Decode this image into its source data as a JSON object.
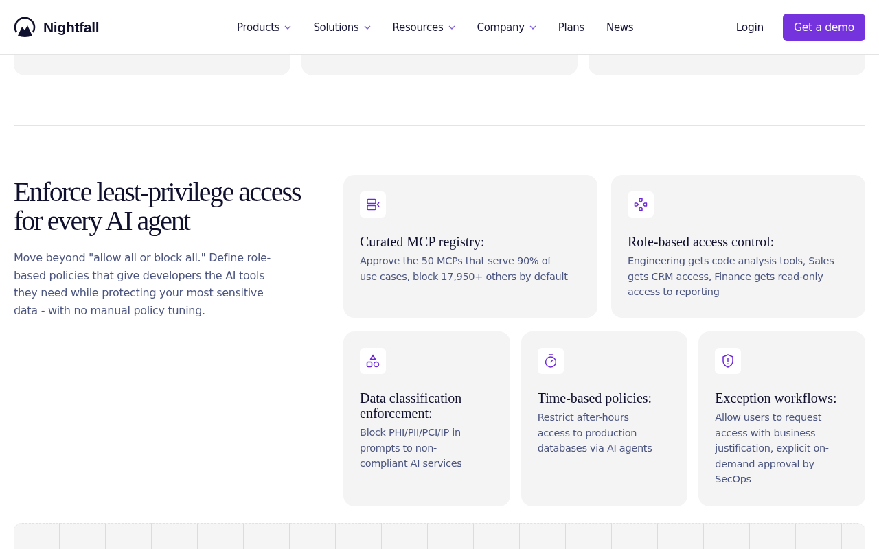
{
  "header": {
    "brand": "Nightfall",
    "nav": [
      {
        "label": "Products",
        "dropdown": true
      },
      {
        "label": "Solutions",
        "dropdown": true
      },
      {
        "label": "Resources",
        "dropdown": true
      },
      {
        "label": "Company",
        "dropdown": true
      },
      {
        "label": "Plans",
        "dropdown": false
      },
      {
        "label": "News",
        "dropdown": false
      }
    ],
    "login": "Login",
    "cta": "Get a demo"
  },
  "section": {
    "heading": "Enforce least-privilege access for every AI agent",
    "description": "Move beyond \"allow all or block all.\" Define role-based policies that give developers the AI tools they need while protecting your most sensitive data - with no manual policy tuning.",
    "features": [
      {
        "kind": "registry",
        "title": "Curated MCP registry:",
        "text": "Approve the 50 MCPs that serve 90% of use cases, block 17,950+ others by default"
      },
      {
        "kind": "roles",
        "title": "Role-based access control:",
        "text": "Engineering gets code analysis tools, Sales gets CRM access, Finance gets read-only access to reporting"
      },
      {
        "kind": "classification",
        "title": "Data classification enforcement:",
        "text": "Block PHI/PII/PCI/IP in prompts to non-compliant AI services"
      },
      {
        "kind": "time",
        "title": "Time-based policies:",
        "text": "Restrict after-hours access to production databases via AI agents"
      },
      {
        "kind": "exception",
        "title": "Exception workflows:",
        "text": "Allow users to request access with business justification, explicit on-demand approval by SecOps"
      }
    ]
  }
}
